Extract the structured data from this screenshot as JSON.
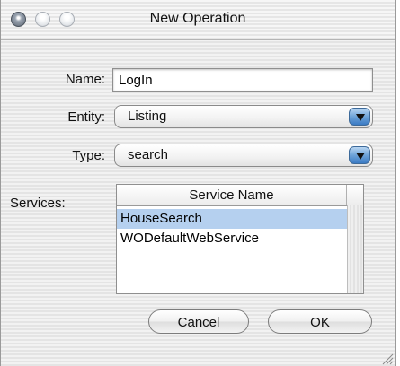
{
  "window": {
    "title": "New Operation"
  },
  "form": {
    "name_label": "Name:",
    "name_value": "LogIn",
    "entity_label": "Entity:",
    "entity_value": "Listing",
    "type_label": "Type:",
    "type_value": "search",
    "services_label": "Services:"
  },
  "services_table": {
    "column_header": "Service Name",
    "rows": [
      "HouseSearch",
      "WODefaultWebService"
    ],
    "selected_index": 0
  },
  "buttons": {
    "cancel": "Cancel",
    "ok": "OK"
  },
  "colors": {
    "selection": "#b5d0ef",
    "popup_arrow": "#3b7bc4"
  }
}
